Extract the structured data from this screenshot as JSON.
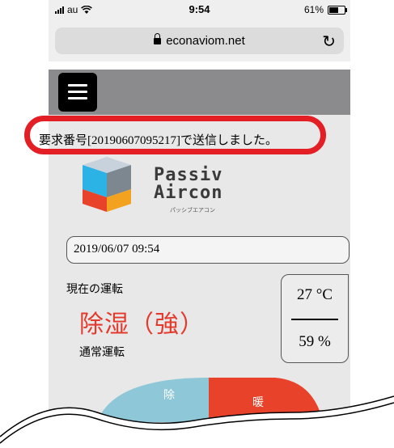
{
  "status_bar": {
    "carrier": "au",
    "time": "9:54",
    "battery": "61%",
    "battery_level": 0.61
  },
  "browser": {
    "url": "econaviom.net",
    "icons": [
      "lock-icon",
      "reload-icon"
    ]
  },
  "header": {
    "menu_icon": "hamburger-menu-icon"
  },
  "message": "要求番号[20190607095217]で送信しました。",
  "logo": {
    "line1": "Passiv",
    "line2": "Aircon",
    "subtitle": "パッシブエアコン"
  },
  "datetime": "2019/06/07 09:54",
  "operation": {
    "label": "現在の運転",
    "mode": "除湿（強）",
    "submode": "通常運転"
  },
  "environment": {
    "temperature": "27 °C",
    "humidity": "59 %"
  },
  "gauge": {
    "labels": [
      "除",
      "暖"
    ],
    "colors": [
      "#2fb4e6",
      "#e8432a",
      "#e3c92f"
    ]
  },
  "colors": {
    "accent_red": "#e31e25",
    "mode_red": "#e43a2c",
    "header_gray": "#8b8b8d"
  }
}
